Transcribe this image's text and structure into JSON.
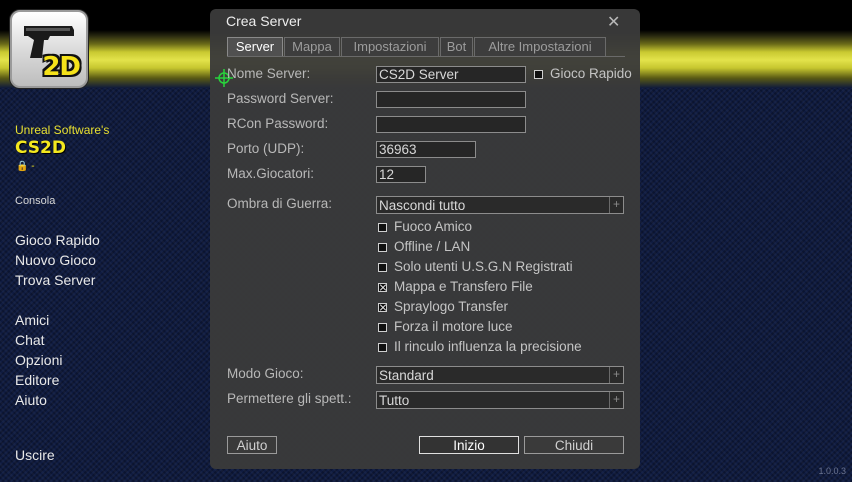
{
  "sidebar": {
    "brand_line": "Unreal Software's",
    "brand_name": "CS2D",
    "lock_line": "🔒 -",
    "console": "Consola",
    "menu_group1": [
      "Gioco Rapido",
      "Nuovo Gioco",
      "Trova Server"
    ],
    "menu_group2": [
      "Amici",
      "Chat",
      "Opzioni",
      "Editore",
      "Aiuto"
    ],
    "quit": "Uscire"
  },
  "logo": {
    "text": "2D"
  },
  "version": "1.0.0.3",
  "dialog": {
    "title": "Crea Server",
    "close": "✕",
    "tabs": [
      "Server",
      "Mappa",
      "Impostazioni",
      "Bot",
      "Altre Impostazioni"
    ],
    "active_tab": "Server",
    "fields": {
      "server_name_label": "Nome Server:",
      "server_name_value": "CS2D Server",
      "quick_game_label": "Gioco Rapido",
      "password_label": "Password Server:",
      "password_value": "",
      "rcon_label": "RCon Password:",
      "rcon_value": "",
      "port_label": "Porto (UDP):",
      "port_value": "36963",
      "max_players_label": "Max.Giocatori:",
      "max_players_value": "12",
      "fog_label": "Ombra di Guerra:",
      "fog_value": "Nascondi tutto",
      "game_mode_label": "Modo Gioco:",
      "game_mode_value": "Standard",
      "spectate_label": "Permettere gli spett.:",
      "spectate_value": "Tutto"
    },
    "options": [
      {
        "label": "Fuoco Amico",
        "checked": false
      },
      {
        "label": "Offline / LAN",
        "checked": false
      },
      {
        "label": "Solo utenti U.S.G.N Registrati",
        "checked": false
      },
      {
        "label": "Mappa e Transfero File",
        "checked": true
      },
      {
        "label": "Spraylogo Transfer",
        "checked": true
      },
      {
        "label": "Forza il motore luce",
        "checked": false
      },
      {
        "label": "Il rinculo influenza la precisione",
        "checked": false
      }
    ],
    "buttons": {
      "help": "Aiuto",
      "start": "Inizio",
      "close": "Chiudi"
    }
  },
  "colors": {
    "accent_yellow": "#f4e81e",
    "dialog_bg": "#3a3a3a",
    "crosshair": "#28d23c"
  }
}
